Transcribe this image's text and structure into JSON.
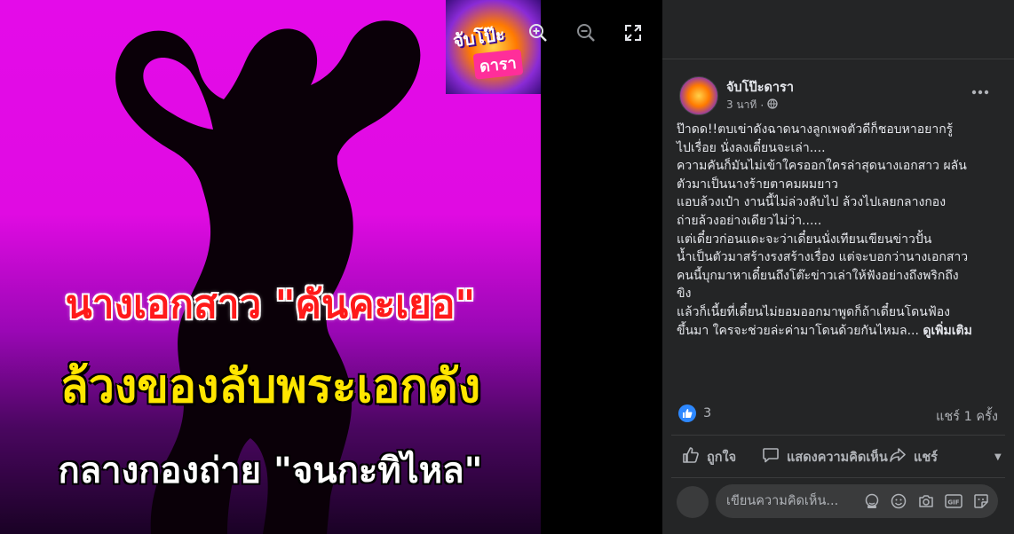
{
  "photo": {
    "headline_1": "นางเอกสาว \"คันคะเยอ\"",
    "headline_2": "ล้วงของลับพระเอกดัง",
    "headline_3": "กลางกองถ่าย \"จนกะทิไหล\"",
    "logo_text_top": "จับโป๊ะ",
    "logo_text_bottom": "ดารา"
  },
  "viewer_controls": [
    "zoom-in-icon",
    "zoom-out-icon",
    "fullscreen-icon"
  ],
  "post": {
    "page_name": "จับโป๊ะดารา",
    "time": "3 นาที",
    "body_lines": [
      "ป๊าดด!!ตบเข่าดังฉาดนางลูกเพจตัวดีก็ชอบหาอยากรู้",
      "ไปเรื่อย นั่งลงเดี๋ยนจะเล่า....",
      "ความคันก็มันไม่เข้าใครออกใครล่าสุดนางเอกสาว ผลัน",
      "ตัวมาเป็นนางร้ายตาคมผมยาว",
      "แอบล้วงเป๋า งานนี้ไม่ล่วงลับไป ล้วงไปเลยกลางกอง",
      "ถ่ายล้วงอย่างเดียวไม่ว่า.....",
      "แต่เดี๋ยวก่อนแดะจะว่าเดี๋ยนนั่งเทียนเขียนข่าวปั้น",
      "น้ำเป็นตัวมาสร้างรงสร้างเรื่อง แต่จะบอกว่านางเอกสาว",
      "คนนี้บุกมาหาเดี๋ยนถึงโต๊ะข่าวเล่าให้ฟังอย่างถึงพริกถึง",
      "ขิง",
      "แล้วก็เนี้ยที่เดี๋ยนไม่ยอมออกมาพูดก็ถ้าเดี๋ยนโดนฟ้อง"
    ],
    "last_line": "ขึ้นมา ใครจะช่วยล่ะค่ามาโดนด้วยกันไหมล...",
    "see_more": "ดูเพิ่มเติม",
    "reaction_count": "3",
    "share_count": "แชร์ 1 ครั้ง",
    "actions": {
      "like": "ถูกใจ",
      "comment": "แสดงความคิดเห็น",
      "share": "แชร์"
    },
    "comment_placeholder": "เขียนความคิดเห็น..."
  },
  "colors": {
    "panel_bg": "#242526",
    "accent_blue": "#2d88ff",
    "photo_magenta": "#e40be9"
  }
}
